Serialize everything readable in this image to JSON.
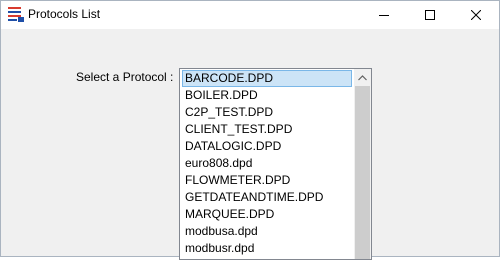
{
  "window": {
    "title": "Protocols List"
  },
  "form": {
    "label": "Select a Protocol :",
    "protocols": [
      "BARCODE.DPD",
      "BOILER.DPD",
      "C2P_TEST.DPD",
      "CLIENT_TEST.DPD",
      "DATALOGIC.DPD",
      "euro808.dpd",
      "FLOWMETER.DPD",
      "GETDATEANDTIME.DPD",
      "MARQUEE.DPD",
      "modbusa.dpd",
      "modbusr.dpd"
    ],
    "selected_index": 0
  }
}
